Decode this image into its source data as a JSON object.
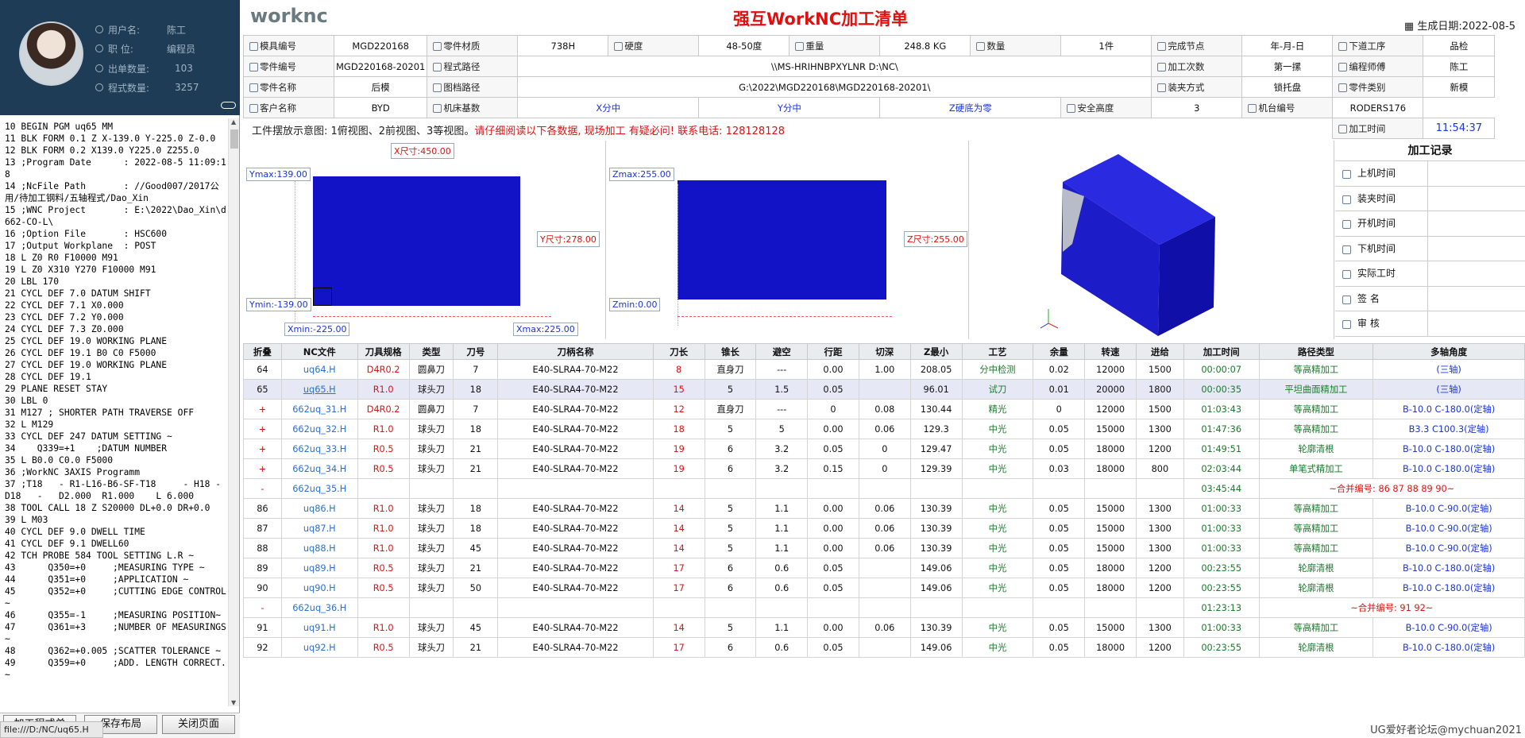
{
  "profile": {
    "username_label": "用户名:",
    "username": "陈工",
    "title_label": "职  位:",
    "title": "编程员",
    "count_label": "出单数量:",
    "count": "103",
    "programs_label": "程式数量:",
    "programs": "3257"
  },
  "code_lines": [
    "10 BEGIN PGM uq65 MM",
    "11 BLK FORM 0.1 Z X-139.0 Y-225.0 Z-0.0",
    "12 BLK FORM 0.2 X139.0 Y225.0 Z255.0",
    "13 ;Program Date      : 2022-08-5 11:09:18",
    "14 ;NcFile Path       : //Good007/2017公用/待加工钢料/五轴程式/Dao_Xin",
    "15 ;WNC Project       : E:\\2022\\Dao_Xin\\d662-CO-L\\",
    "16 ;Option File       : HSC600",
    "17 ;Output Workplane  : POST",
    "18 L Z0 R0 F10000 M91",
    "19 L Z0 X310 Y270 F10000 M91",
    "20 LBL 170",
    "21 CYCL DEF 7.0 DATUM SHIFT",
    "22 CYCL DEF 7.1 X0.000",
    "23 CYCL DEF 7.2 Y0.000",
    "24 CYCL DEF 7.3 Z0.000",
    "25 CYCL DEF 19.0 WORKING PLANE",
    "26 CYCL DEF 19.1 B0 C0 F5000",
    "27 CYCL DEF 19.0 WORKING PLANE",
    "28 CYCL DEF 19.1",
    "29 PLANE RESET STAY",
    "30 LBL 0",
    "31 M127 ; SHORTER PATH TRAVERSE OFF",
    "32 L M129",
    "33 CYCL DEF 247 DATUM SETTING ~",
    "34    Q339=+1    ;DATUM NUMBER",
    "35 L B0.0 C0.0 F5000",
    "36 ;WorkNC 3AXIS Programm",
    "37 ;T18   - R1-L16-B6-SF-T18     - H18 - D18   -   D2.000  R1.000    L 6.000",
    "38 TOOL CALL 18 Z S20000 DL+0.0 DR+0.0",
    "39 L M03",
    "40 CYCL DEF 9.0 DWELL TIME",
    "41 CYCL DEF 9.1 DWELL60",
    "42 TCH PROBE 584 TOOL SETTING L.R ~",
    "43      Q350=+0     ;MEASURING TYPE ~",
    "44      Q351=+0     ;APPLICATION ~",
    "45      Q352=+0     ;CUTTING EDGE CONTROL ~",
    "46      Q355=-1     ;MEASURING POSITION~",
    "47      Q361=+3     ;NUMBER OF MEASURINGS ~",
    "48      Q362=+0.005 ;SCATTER TOLERANCE ~",
    "49      Q359=+0     ;ADD. LENGTH CORRECT.~"
  ],
  "buttons": {
    "b1": "加工程式单",
    "b2": "保存布局",
    "b3": "关闭页面"
  },
  "statusbar": "file:///D:/NC/uq65.H",
  "header": {
    "logo": "worknc",
    "title": "强互WorkNC加工清单",
    "date_label": "生成日期:",
    "date": "2022-08-5"
  },
  "info": {
    "mold_no_l": "模具编号",
    "mold_no": "MGD220168",
    "material_l": "零件材质",
    "material": "738H",
    "hardness_l": "硬度",
    "hardness": "48-50度",
    "weight_l": "重量",
    "weight": "248.8 KG",
    "qty_l": "数量",
    "qty": "1件",
    "finish_l": "完成节点",
    "finish": "年-月-日",
    "next_l": "下道工序",
    "next": "品检",
    "part_no_l": "零件编号",
    "part_no": "MGD220168-20201",
    "prog_path_l": "程式路径",
    "prog_path": "\\\\MS-HRIHNBPXYLNR D:\\NC\\",
    "times_l": "加工次数",
    "times": "第一摞",
    "programmer_l": "编程师傅",
    "programmer": "陈工",
    "part_name_l": "零件名称",
    "part_name": "后模",
    "drawing_l": "图档路径",
    "drawing": "G:\\2022\\MGD220168\\MGD220168-20201\\",
    "clamp_l": "装夹方式",
    "clamp": "锁托盘",
    "category_l": "零件类别",
    "category": "新模",
    "client_l": "客户名称",
    "client": "BYD",
    "machine_l": "机床基数",
    "xs": "X分中",
    "ys": "Y分中",
    "zs": "Z硬底为零",
    "safe_l": "安全高度",
    "safe": "3",
    "mach_no_l": "机台编号",
    "mach_no": "RODERS176",
    "time_l": "加工时间",
    "time": "11:54:37"
  },
  "notice": {
    "a": "工件摆放示意图:  1俯视图、2前视图、3等视图。",
    "b": "请仔细阅读以下各数据, 现场加工 有疑必问!  联系电话: 128128128"
  },
  "views": {
    "xsize": "X尺寸:450.00",
    "ymax": "Ymax:139.00",
    "ysize": "Y尺寸:278.00",
    "ymin": "Ymin:-139.00",
    "xmin": "Xmin:-225.00",
    "xmax": "Xmax:225.00",
    "zmax": "Zmax:255.00",
    "zsize": "Z尺寸:255.00",
    "zmin": "Zmin:0.00"
  },
  "record": {
    "title": "加工记录",
    "rows": [
      "上机时间",
      "装夹时间",
      "开机时间",
      "下机时间",
      "实际工时",
      "签    名",
      "审    核"
    ]
  },
  "ops_headers": [
    "折叠",
    "NC文件",
    "刀具规格",
    "类型",
    "刀号",
    "刀柄名称",
    "刀长",
    "锥长",
    "避空",
    "行距",
    "切深",
    "Z最小",
    "工艺",
    "余量",
    "转速",
    "进给",
    "加工时间",
    "路径类型",
    "多轴角度"
  ],
  "ops": [
    [
      "64",
      "uq64.H",
      "D4R0.2",
      "圆鼻刀",
      "7",
      "E40-SLRA4-70-M22",
      "8",
      "直身刀",
      "---",
      "0.00",
      "1.00",
      "208.05",
      "分中检测",
      "0.02",
      "12000",
      "1500",
      "00:00:07",
      "等高精加工",
      "(三轴)"
    ],
    [
      "65",
      "uq65.H",
      "R1.0",
      "球头刀",
      "18",
      "E40-SLRA4-70-M22",
      "15",
      "5",
      "1.5",
      "0.05",
      "",
      "96.01",
      "试刀",
      "0.01",
      "20000",
      "1800",
      "00:00:35",
      "平坦曲面精加工",
      "(三轴)"
    ],
    [
      "+",
      "662uq_31.H",
      "D4R0.2",
      "圆鼻刀",
      "7",
      "E40-SLRA4-70-M22",
      "12",
      "直身刀",
      "---",
      "0",
      "0.08",
      "130.44",
      "精光",
      "0",
      "12000",
      "1500",
      "01:03:43",
      "等高精加工",
      "B-10.0 C-180.0(定轴)"
    ],
    [
      "+",
      "662uq_32.H",
      "R1.0",
      "球头刀",
      "18",
      "E40-SLRA4-70-M22",
      "18",
      "5",
      "5",
      "0.00",
      "0.06",
      "129.3",
      "中光",
      "0.05",
      "15000",
      "1300",
      "01:47:36",
      "等高精加工",
      "B3.3 C100.3(定轴)"
    ],
    [
      "+",
      "662uq_33.H",
      "R0.5",
      "球头刀",
      "21",
      "E40-SLRA4-70-M22",
      "19",
      "6",
      "3.2",
      "0.05",
      "0",
      "129.47",
      "中光",
      "0.05",
      "18000",
      "1200",
      "01:49:51",
      "轮廓清根",
      "B-10.0 C-180.0(定轴)"
    ],
    [
      "+",
      "662uq_34.H",
      "R0.5",
      "球头刀",
      "21",
      "E40-SLRA4-70-M22",
      "19",
      "6",
      "3.2",
      "0.15",
      "0",
      "129.39",
      "中光",
      "0.03",
      "18000",
      "800",
      "02:03:44",
      "单笔式精加工",
      "B-10.0 C-180.0(定轴)"
    ],
    [
      "-",
      "662uq_35.H",
      "",
      "",
      "",
      "",
      "",
      "",
      "",
      "",
      "",
      "",
      "",
      "",
      "",
      "",
      "03:45:44",
      "~合并编号: 86 87 88 89 90~",
      ""
    ],
    [
      "86",
      "uq86.H",
      "R1.0",
      "球头刀",
      "18",
      "E40-SLRA4-70-M22",
      "14",
      "5",
      "1.1",
      "0.00",
      "0.06",
      "130.39",
      "中光",
      "0.05",
      "15000",
      "1300",
      "01:00:33",
      "等高精加工",
      "B-10.0 C-90.0(定轴)"
    ],
    [
      "87",
      "uq87.H",
      "R1.0",
      "球头刀",
      "18",
      "E40-SLRA4-70-M22",
      "14",
      "5",
      "1.1",
      "0.00",
      "0.06",
      "130.39",
      "中光",
      "0.05",
      "15000",
      "1300",
      "01:00:33",
      "等高精加工",
      "B-10.0 C-90.0(定轴)"
    ],
    [
      "88",
      "uq88.H",
      "R1.0",
      "球头刀",
      "45",
      "E40-SLRA4-70-M22",
      "14",
      "5",
      "1.1",
      "0.00",
      "0.06",
      "130.39",
      "中光",
      "0.05",
      "15000",
      "1300",
      "01:00:33",
      "等高精加工",
      "B-10.0 C-90.0(定轴)"
    ],
    [
      "89",
      "uq89.H",
      "R0.5",
      "球头刀",
      "21",
      "E40-SLRA4-70-M22",
      "17",
      "6",
      "0.6",
      "0.05",
      "",
      "149.06",
      "中光",
      "0.05",
      "18000",
      "1200",
      "00:23:55",
      "轮廓清根",
      "B-10.0 C-180.0(定轴)"
    ],
    [
      "90",
      "uq90.H",
      "R0.5",
      "球头刀",
      "50",
      "E40-SLRA4-70-M22",
      "17",
      "6",
      "0.6",
      "0.05",
      "",
      "149.06",
      "中光",
      "0.05",
      "18000",
      "1200",
      "00:23:55",
      "轮廓清根",
      "B-10.0 C-180.0(定轴)"
    ],
    [
      "-",
      "662uq_36.H",
      "",
      "",
      "",
      "",
      "",
      "",
      "",
      "",
      "",
      "",
      "",
      "",
      "",
      "",
      "01:23:13",
      "~合并编号: 91 92~",
      ""
    ],
    [
      "91",
      "uq91.H",
      "R1.0",
      "球头刀",
      "45",
      "E40-SLRA4-70-M22",
      "14",
      "5",
      "1.1",
      "0.00",
      "0.06",
      "130.39",
      "中光",
      "0.05",
      "15000",
      "1300",
      "01:00:33",
      "等高精加工",
      "B-10.0 C-90.0(定轴)"
    ],
    [
      "92",
      "uq92.H",
      "R0.5",
      "球头刀",
      "21",
      "E40-SLRA4-70-M22",
      "17",
      "6",
      "0.6",
      "0.05",
      "",
      "149.06",
      "中光",
      "0.05",
      "18000",
      "1200",
      "00:23:55",
      "轮廓清根",
      "B-10.0 C-180.0(定轴)"
    ]
  ],
  "watermark": "UG爱好者论坛@mychuan2021"
}
